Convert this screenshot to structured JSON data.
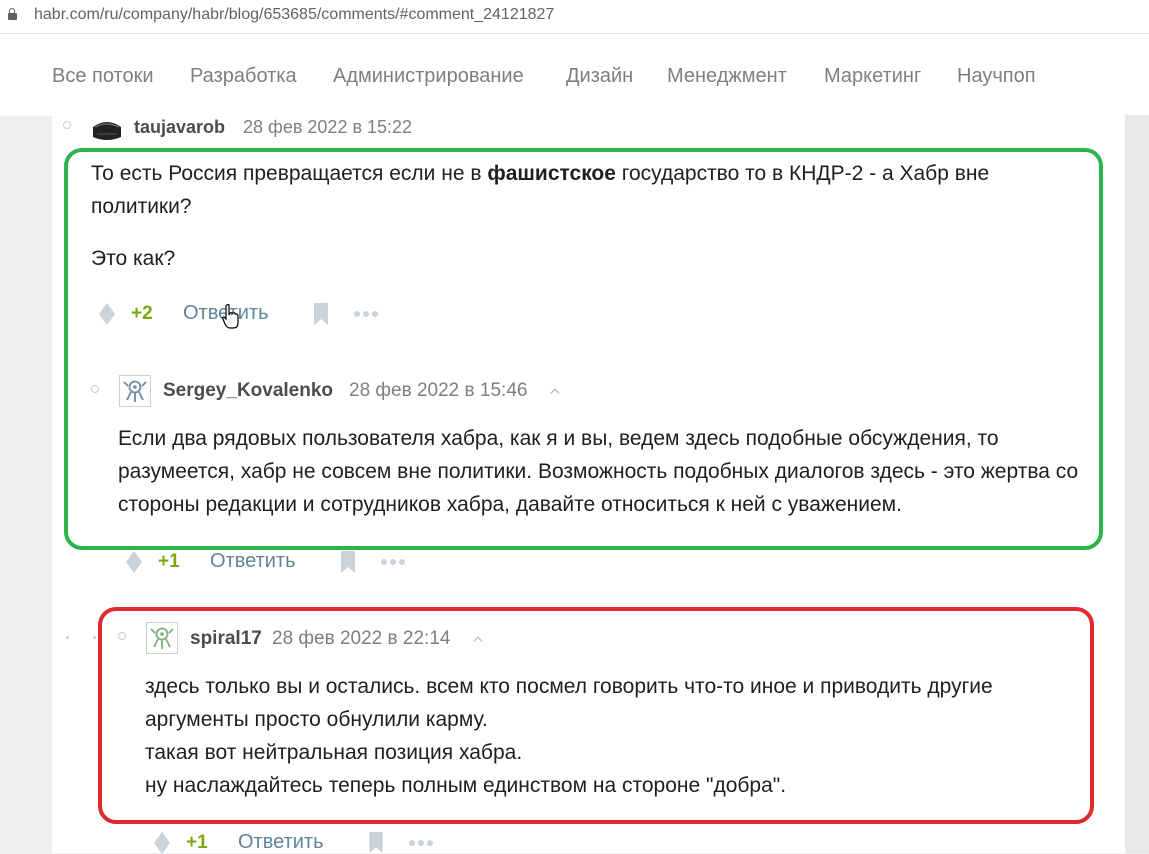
{
  "browser": {
    "url": "habr.com/ru/company/habr/blog/653685/comments/#comment_24121827"
  },
  "nav": {
    "items": [
      "Все потоки",
      "Разработка",
      "Администрирование",
      "Дизайн",
      "Менеджмент",
      "Маркетинг",
      "Научпоп"
    ]
  },
  "comments": [
    {
      "author": "taujavarob",
      "time": "28 фев 2022 в 15:22",
      "text_p1_before": "То есть Россия превращается если не в ",
      "text_p1_bold": "фашистское",
      "text_p1_after": " государство то в КНДР-2 - а Хабр вне политики?",
      "text_p2": "Это как?",
      "score": "+2",
      "reply_label": "Ответить"
    },
    {
      "author": "Sergey_Kovalenko",
      "time": "28 фев 2022 в 15:46",
      "text": "Если два рядовых пользователя хабра, как я и вы, ведем здесь подобные обсуждения, то разумеется, хабр не совсем вне политики. Возможность подобных диалогов здесь - это жертва со стороны редакции и сотрудников хабра, давайте относиться к ней с уважением.",
      "score": "+1",
      "reply_label": "Ответить"
    },
    {
      "author": "spiral17",
      "time": "28 фев 2022 в 22:14",
      "lines": [
        "здесь только вы и остались. всем кто посмел говорить что-то иное и приводить другие аргументы просто обнулили карму.",
        "такая вот нейтральная позиция хабра.",
        "ну наслаждайтесь теперь полным единством на стороне \"добра\"."
      ],
      "score": "+1",
      "reply_label": "Ответить"
    }
  ],
  "colors": {
    "highlight_green": "#2cb34a",
    "highlight_red": "#e02a2f",
    "positive_score": "#7ba80a",
    "reply_link": "#5f859a"
  }
}
